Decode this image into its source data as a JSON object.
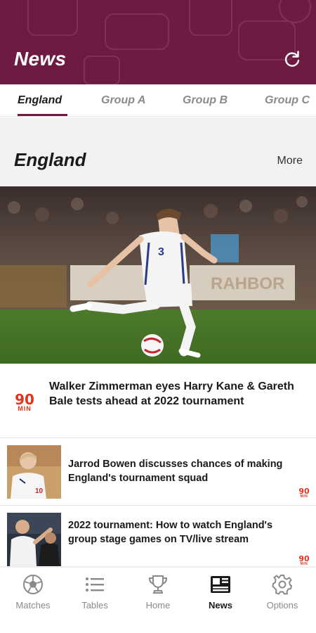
{
  "header": {
    "title": "News",
    "refresh_icon": "refresh-icon"
  },
  "tabs": [
    {
      "label": "England",
      "active": true
    },
    {
      "label": "Group A"
    },
    {
      "label": "Group B"
    },
    {
      "label": "Group C"
    }
  ],
  "section": {
    "title": "England",
    "more_label": "More"
  },
  "feature": {
    "title": "Walker Zimmerman eyes Harry Kane & Gareth Bale tests ahead at 2022 tournament",
    "source_logo": {
      "number": "90",
      "word": "MIN"
    }
  },
  "articles": [
    {
      "title": "Jarrod Bowen discusses chances of making England's tournament squad",
      "source_logo": {
        "number": "90",
        "word": "MIN"
      }
    },
    {
      "title": "2022 tournament: How to watch England's group stage games on TV/live stream",
      "source_logo": {
        "number": "90",
        "word": "MIN"
      }
    }
  ],
  "bottom_nav": [
    {
      "label": "Matches",
      "icon": "soccer-ball-icon"
    },
    {
      "label": "Tables",
      "icon": "list-icon"
    },
    {
      "label": "Home",
      "icon": "trophy-icon"
    },
    {
      "label": "News",
      "icon": "newspaper-icon",
      "active": true
    },
    {
      "label": "Options",
      "icon": "gear-icon"
    }
  ],
  "colors": {
    "brand": "#6e1a42",
    "source_logo": "#e0341e",
    "muted_text": "#8a8a8a"
  }
}
